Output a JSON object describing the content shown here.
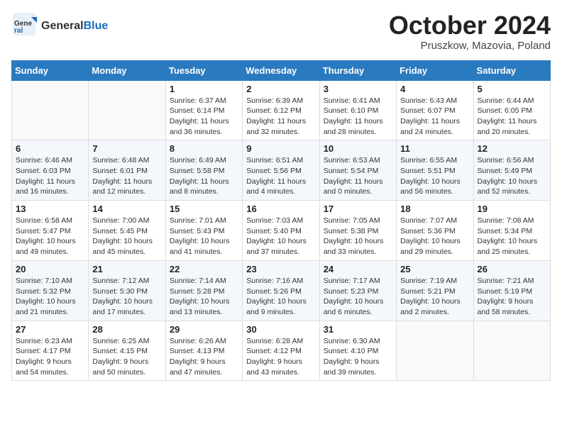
{
  "header": {
    "logo_general": "General",
    "logo_blue": "Blue",
    "month_title": "October 2024",
    "subtitle": "Pruszkow, Mazovia, Poland"
  },
  "days_of_week": [
    "Sunday",
    "Monday",
    "Tuesday",
    "Wednesday",
    "Thursday",
    "Friday",
    "Saturday"
  ],
  "weeks": [
    [
      {
        "day": "",
        "info": ""
      },
      {
        "day": "",
        "info": ""
      },
      {
        "day": "1",
        "info": "Sunrise: 6:37 AM\nSunset: 6:14 PM\nDaylight: 11 hours\nand 36 minutes."
      },
      {
        "day": "2",
        "info": "Sunrise: 6:39 AM\nSunset: 6:12 PM\nDaylight: 11 hours\nand 32 minutes."
      },
      {
        "day": "3",
        "info": "Sunrise: 6:41 AM\nSunset: 6:10 PM\nDaylight: 11 hours\nand 28 minutes."
      },
      {
        "day": "4",
        "info": "Sunrise: 6:43 AM\nSunset: 6:07 PM\nDaylight: 11 hours\nand 24 minutes."
      },
      {
        "day": "5",
        "info": "Sunrise: 6:44 AM\nSunset: 6:05 PM\nDaylight: 11 hours\nand 20 minutes."
      }
    ],
    [
      {
        "day": "6",
        "info": "Sunrise: 6:46 AM\nSunset: 6:03 PM\nDaylight: 11 hours\nand 16 minutes."
      },
      {
        "day": "7",
        "info": "Sunrise: 6:48 AM\nSunset: 6:01 PM\nDaylight: 11 hours\nand 12 minutes."
      },
      {
        "day": "8",
        "info": "Sunrise: 6:49 AM\nSunset: 5:58 PM\nDaylight: 11 hours\nand 8 minutes."
      },
      {
        "day": "9",
        "info": "Sunrise: 6:51 AM\nSunset: 5:56 PM\nDaylight: 11 hours\nand 4 minutes."
      },
      {
        "day": "10",
        "info": "Sunrise: 6:53 AM\nSunset: 5:54 PM\nDaylight: 11 hours\nand 0 minutes."
      },
      {
        "day": "11",
        "info": "Sunrise: 6:55 AM\nSunset: 5:51 PM\nDaylight: 10 hours\nand 56 minutes."
      },
      {
        "day": "12",
        "info": "Sunrise: 6:56 AM\nSunset: 5:49 PM\nDaylight: 10 hours\nand 52 minutes."
      }
    ],
    [
      {
        "day": "13",
        "info": "Sunrise: 6:58 AM\nSunset: 5:47 PM\nDaylight: 10 hours\nand 49 minutes."
      },
      {
        "day": "14",
        "info": "Sunrise: 7:00 AM\nSunset: 5:45 PM\nDaylight: 10 hours\nand 45 minutes."
      },
      {
        "day": "15",
        "info": "Sunrise: 7:01 AM\nSunset: 5:43 PM\nDaylight: 10 hours\nand 41 minutes."
      },
      {
        "day": "16",
        "info": "Sunrise: 7:03 AM\nSunset: 5:40 PM\nDaylight: 10 hours\nand 37 minutes."
      },
      {
        "day": "17",
        "info": "Sunrise: 7:05 AM\nSunset: 5:38 PM\nDaylight: 10 hours\nand 33 minutes."
      },
      {
        "day": "18",
        "info": "Sunrise: 7:07 AM\nSunset: 5:36 PM\nDaylight: 10 hours\nand 29 minutes."
      },
      {
        "day": "19",
        "info": "Sunrise: 7:08 AM\nSunset: 5:34 PM\nDaylight: 10 hours\nand 25 minutes."
      }
    ],
    [
      {
        "day": "20",
        "info": "Sunrise: 7:10 AM\nSunset: 5:32 PM\nDaylight: 10 hours\nand 21 minutes."
      },
      {
        "day": "21",
        "info": "Sunrise: 7:12 AM\nSunset: 5:30 PM\nDaylight: 10 hours\nand 17 minutes."
      },
      {
        "day": "22",
        "info": "Sunrise: 7:14 AM\nSunset: 5:28 PM\nDaylight: 10 hours\nand 13 minutes."
      },
      {
        "day": "23",
        "info": "Sunrise: 7:16 AM\nSunset: 5:26 PM\nDaylight: 10 hours\nand 9 minutes."
      },
      {
        "day": "24",
        "info": "Sunrise: 7:17 AM\nSunset: 5:23 PM\nDaylight: 10 hours\nand 6 minutes."
      },
      {
        "day": "25",
        "info": "Sunrise: 7:19 AM\nSunset: 5:21 PM\nDaylight: 10 hours\nand 2 minutes."
      },
      {
        "day": "26",
        "info": "Sunrise: 7:21 AM\nSunset: 5:19 PM\nDaylight: 9 hours\nand 58 minutes."
      }
    ],
    [
      {
        "day": "27",
        "info": "Sunrise: 6:23 AM\nSunset: 4:17 PM\nDaylight: 9 hours\nand 54 minutes."
      },
      {
        "day": "28",
        "info": "Sunrise: 6:25 AM\nSunset: 4:15 PM\nDaylight: 9 hours\nand 50 minutes."
      },
      {
        "day": "29",
        "info": "Sunrise: 6:26 AM\nSunset: 4:13 PM\nDaylight: 9 hours\nand 47 minutes."
      },
      {
        "day": "30",
        "info": "Sunrise: 6:28 AM\nSunset: 4:12 PM\nDaylight: 9 hours\nand 43 minutes."
      },
      {
        "day": "31",
        "info": "Sunrise: 6:30 AM\nSunset: 4:10 PM\nDaylight: 9 hours\nand 39 minutes."
      },
      {
        "day": "",
        "info": ""
      },
      {
        "day": "",
        "info": ""
      }
    ]
  ]
}
